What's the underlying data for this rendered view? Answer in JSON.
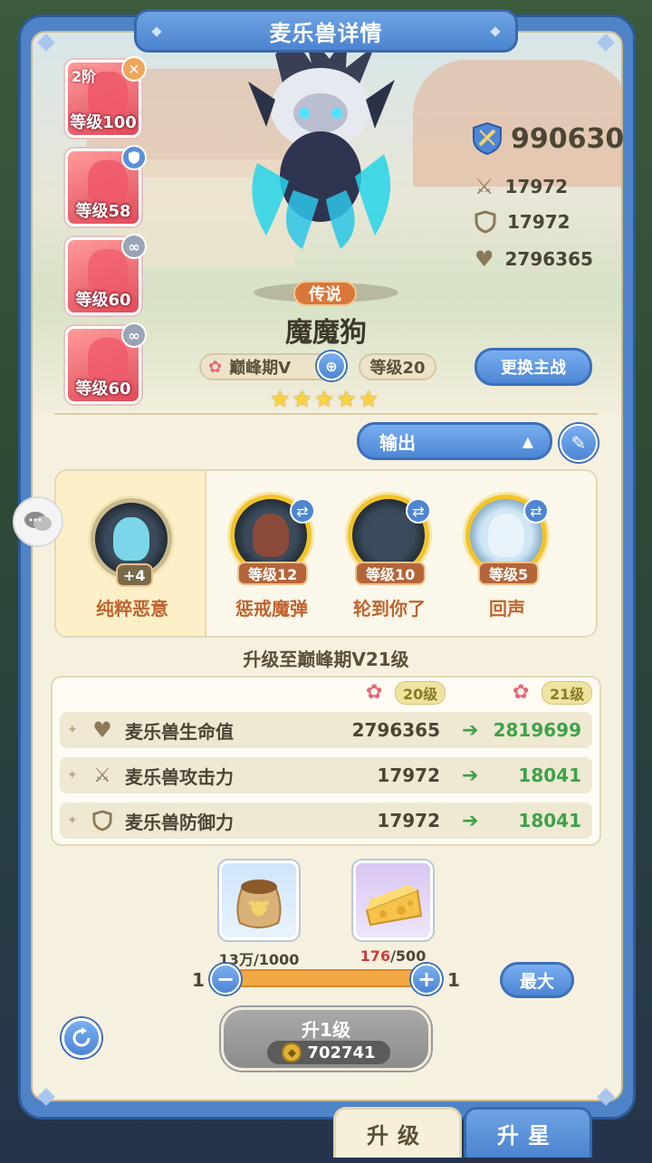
{
  "title": "麦乐兽详情",
  "side_cards": [
    {
      "tier": "2阶",
      "level": "等级100",
      "badge": "close"
    },
    {
      "level": "等级58",
      "badge": "shield"
    },
    {
      "level": "等级60",
      "badge": "link"
    },
    {
      "level": "等级60",
      "badge": "link"
    }
  ],
  "stats": {
    "power": "990630",
    "attack": "17972",
    "defense": "17972",
    "hp": "2796365"
  },
  "pet": {
    "rarity": "传说",
    "name": "魔魔狗",
    "stage": "巅峰期V",
    "level": "等级20",
    "stars": 5,
    "switch_label": "更换主战"
  },
  "role_select": {
    "value": "输出"
  },
  "skills": [
    {
      "name": "纯粹恶意",
      "plus": "+4"
    },
    {
      "name": "惩戒魔弹",
      "level": "等级12"
    },
    {
      "name": "轮到你了",
      "level": "等级10"
    },
    {
      "name": "回声",
      "level": "等级5"
    }
  ],
  "upgrade": {
    "title": "升级至巅峰期V21级",
    "from_level": "20级",
    "to_level": "21级",
    "rows": [
      {
        "label": "麦乐兽生命值",
        "from": "2796365",
        "to": "2819699",
        "icon": "heart-icon"
      },
      {
        "label": "麦乐兽攻击力",
        "from": "17972",
        "to": "18041",
        "icon": "swords-icon"
      },
      {
        "label": "麦乐兽防御力",
        "from": "17972",
        "to": "18041",
        "icon": "shield-icon"
      }
    ]
  },
  "materials": [
    {
      "have": "13万",
      "need": "/1000"
    },
    {
      "have": "176",
      "need": "/500"
    }
  ],
  "quantity": {
    "min": "1",
    "max": "1",
    "max_label": "最大"
  },
  "level_button": {
    "label": "升1级",
    "cost": "702741"
  },
  "tabs": {
    "upgrade": "升级",
    "star": "升星"
  },
  "colors": {
    "frame": "#4f83c8",
    "accent_green": "#3da24a",
    "skill_orange": "#c0642f"
  }
}
